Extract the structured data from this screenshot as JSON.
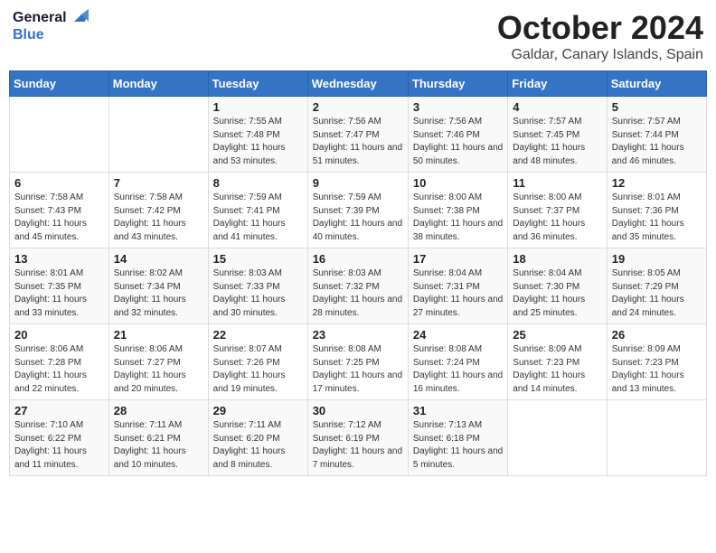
{
  "header": {
    "logo_general": "General",
    "logo_blue": "Blue",
    "month_title": "October 2024",
    "location": "Galdar, Canary Islands, Spain"
  },
  "weekdays": [
    "Sunday",
    "Monday",
    "Tuesday",
    "Wednesday",
    "Thursday",
    "Friday",
    "Saturday"
  ],
  "weeks": [
    [
      {
        "day": "",
        "info": ""
      },
      {
        "day": "",
        "info": ""
      },
      {
        "day": "1",
        "info": "Sunrise: 7:55 AM\nSunset: 7:48 PM\nDaylight: 11 hours and 53 minutes."
      },
      {
        "day": "2",
        "info": "Sunrise: 7:56 AM\nSunset: 7:47 PM\nDaylight: 11 hours and 51 minutes."
      },
      {
        "day": "3",
        "info": "Sunrise: 7:56 AM\nSunset: 7:46 PM\nDaylight: 11 hours and 50 minutes."
      },
      {
        "day": "4",
        "info": "Sunrise: 7:57 AM\nSunset: 7:45 PM\nDaylight: 11 hours and 48 minutes."
      },
      {
        "day": "5",
        "info": "Sunrise: 7:57 AM\nSunset: 7:44 PM\nDaylight: 11 hours and 46 minutes."
      }
    ],
    [
      {
        "day": "6",
        "info": "Sunrise: 7:58 AM\nSunset: 7:43 PM\nDaylight: 11 hours and 45 minutes."
      },
      {
        "day": "7",
        "info": "Sunrise: 7:58 AM\nSunset: 7:42 PM\nDaylight: 11 hours and 43 minutes."
      },
      {
        "day": "8",
        "info": "Sunrise: 7:59 AM\nSunset: 7:41 PM\nDaylight: 11 hours and 41 minutes."
      },
      {
        "day": "9",
        "info": "Sunrise: 7:59 AM\nSunset: 7:39 PM\nDaylight: 11 hours and 40 minutes."
      },
      {
        "day": "10",
        "info": "Sunrise: 8:00 AM\nSunset: 7:38 PM\nDaylight: 11 hours and 38 minutes."
      },
      {
        "day": "11",
        "info": "Sunrise: 8:00 AM\nSunset: 7:37 PM\nDaylight: 11 hours and 36 minutes."
      },
      {
        "day": "12",
        "info": "Sunrise: 8:01 AM\nSunset: 7:36 PM\nDaylight: 11 hours and 35 minutes."
      }
    ],
    [
      {
        "day": "13",
        "info": "Sunrise: 8:01 AM\nSunset: 7:35 PM\nDaylight: 11 hours and 33 minutes."
      },
      {
        "day": "14",
        "info": "Sunrise: 8:02 AM\nSunset: 7:34 PM\nDaylight: 11 hours and 32 minutes."
      },
      {
        "day": "15",
        "info": "Sunrise: 8:03 AM\nSunset: 7:33 PM\nDaylight: 11 hours and 30 minutes."
      },
      {
        "day": "16",
        "info": "Sunrise: 8:03 AM\nSunset: 7:32 PM\nDaylight: 11 hours and 28 minutes."
      },
      {
        "day": "17",
        "info": "Sunrise: 8:04 AM\nSunset: 7:31 PM\nDaylight: 11 hours and 27 minutes."
      },
      {
        "day": "18",
        "info": "Sunrise: 8:04 AM\nSunset: 7:30 PM\nDaylight: 11 hours and 25 minutes."
      },
      {
        "day": "19",
        "info": "Sunrise: 8:05 AM\nSunset: 7:29 PM\nDaylight: 11 hours and 24 minutes."
      }
    ],
    [
      {
        "day": "20",
        "info": "Sunrise: 8:06 AM\nSunset: 7:28 PM\nDaylight: 11 hours and 22 minutes."
      },
      {
        "day": "21",
        "info": "Sunrise: 8:06 AM\nSunset: 7:27 PM\nDaylight: 11 hours and 20 minutes."
      },
      {
        "day": "22",
        "info": "Sunrise: 8:07 AM\nSunset: 7:26 PM\nDaylight: 11 hours and 19 minutes."
      },
      {
        "day": "23",
        "info": "Sunrise: 8:08 AM\nSunset: 7:25 PM\nDaylight: 11 hours and 17 minutes."
      },
      {
        "day": "24",
        "info": "Sunrise: 8:08 AM\nSunset: 7:24 PM\nDaylight: 11 hours and 16 minutes."
      },
      {
        "day": "25",
        "info": "Sunrise: 8:09 AM\nSunset: 7:23 PM\nDaylight: 11 hours and 14 minutes."
      },
      {
        "day": "26",
        "info": "Sunrise: 8:09 AM\nSunset: 7:23 PM\nDaylight: 11 hours and 13 minutes."
      }
    ],
    [
      {
        "day": "27",
        "info": "Sunrise: 7:10 AM\nSunset: 6:22 PM\nDaylight: 11 hours and 11 minutes."
      },
      {
        "day": "28",
        "info": "Sunrise: 7:11 AM\nSunset: 6:21 PM\nDaylight: 11 hours and 10 minutes."
      },
      {
        "day": "29",
        "info": "Sunrise: 7:11 AM\nSunset: 6:20 PM\nDaylight: 11 hours and 8 minutes."
      },
      {
        "day": "30",
        "info": "Sunrise: 7:12 AM\nSunset: 6:19 PM\nDaylight: 11 hours and 7 minutes."
      },
      {
        "day": "31",
        "info": "Sunrise: 7:13 AM\nSunset: 6:18 PM\nDaylight: 11 hours and 5 minutes."
      },
      {
        "day": "",
        "info": ""
      },
      {
        "day": "",
        "info": ""
      }
    ]
  ]
}
